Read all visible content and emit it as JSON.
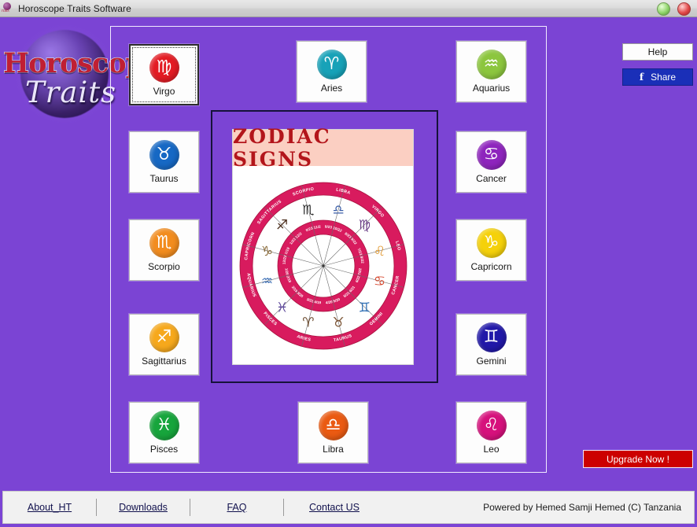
{
  "window": {
    "title": "Horoscope Traits Software",
    "icon": "app-orb-icon",
    "minimize_label": "",
    "close_label": ""
  },
  "logo": {
    "word": "Horoscope",
    "script": "Traits"
  },
  "signs": [
    {
      "label": "Virgo",
      "color": "#e31b23",
      "glyph": "♍",
      "selected": true
    },
    {
      "label": "Aries",
      "color": "#17a2b8",
      "glyph": "♈",
      "selected": false
    },
    {
      "label": "Aquarius",
      "color": "#8cc63e",
      "glyph": "♒",
      "selected": false
    },
    {
      "label": "Taurus",
      "color": "#1668c4",
      "glyph": "♉",
      "selected": false
    },
    {
      "label": "Cancer",
      "color": "#8e24bd",
      "glyph": "♋",
      "selected": false
    },
    {
      "label": "Scorpio",
      "color": "#f28c1e",
      "glyph": "♏",
      "selected": false
    },
    {
      "label": "Capricorn",
      "color": "#f5d10a",
      "glyph": "♑",
      "selected": false
    },
    {
      "label": "Sagittarius",
      "color": "#f6a81c",
      "glyph": "♐",
      "selected": false
    },
    {
      "label": "Gemini",
      "color": "#2118a8",
      "glyph": "♊",
      "selected": false
    },
    {
      "label": "Pisces",
      "color": "#17a53c",
      "glyph": "♓",
      "selected": false
    },
    {
      "label": "Libra",
      "color": "#ea5a12",
      "glyph": "♎",
      "selected": false
    },
    {
      "label": "Leo",
      "color": "#d6117c",
      "glyph": "♌",
      "selected": false
    }
  ],
  "poster": {
    "caption": "ZODIAC  SIGNS",
    "ring_color": "#d81b5e",
    "wheel_signs": [
      {
        "name": "CAPRICORN",
        "dates": "12/22 1/19"
      },
      {
        "name": "SAGITTARIUS",
        "dates": "11/23 12/21"
      },
      {
        "name": "SCORPIO",
        "dates": "10/23 11/22"
      },
      {
        "name": "LIBRA",
        "dates": "9/23 10/22"
      },
      {
        "name": "VIRGO",
        "dates": "8/23 9/22"
      },
      {
        "name": "LEO",
        "dates": "7/23 8/22"
      },
      {
        "name": "CANCER",
        "dates": "6/22 7/22"
      },
      {
        "name": "GEMINI",
        "dates": "5/21 6/21"
      },
      {
        "name": "TAURUS",
        "dates": "4/20 5/20"
      },
      {
        "name": "ARIES",
        "dates": "3/21 4/19"
      },
      {
        "name": "PISCES",
        "dates": "2/19 3/20"
      },
      {
        "name": "AQUARIUS",
        "dates": "1/20 2/18"
      }
    ]
  },
  "actions": {
    "help_label": "Help",
    "share_f": "f",
    "share_label": "Share",
    "upgrade_label": "Upgrade Now !"
  },
  "footer": {
    "links": [
      "About_HT",
      "Downloads",
      "FAQ",
      "Contact US"
    ],
    "powered": "Powered by Hemed Samji Hemed (C) Tanzania"
  }
}
